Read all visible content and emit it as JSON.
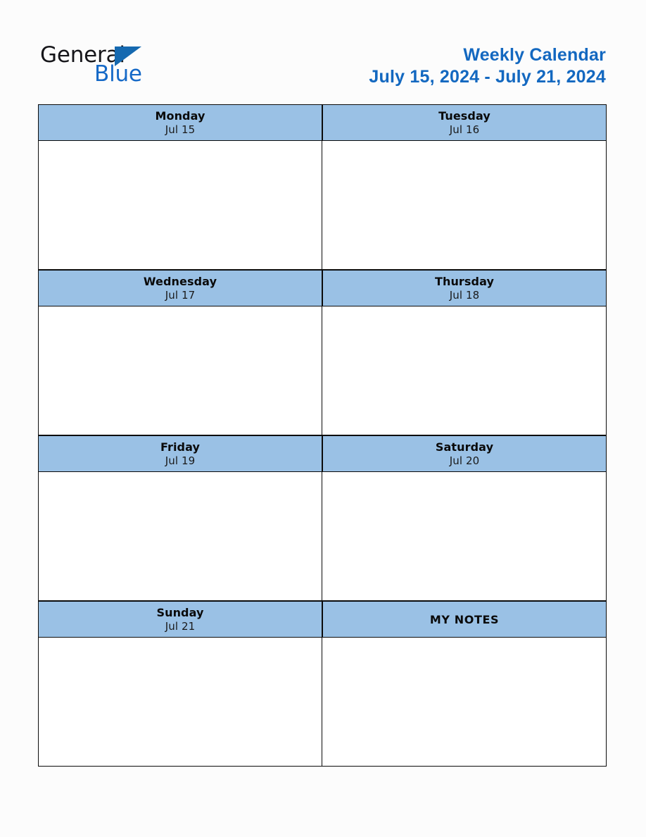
{
  "logo": {
    "word_primary": "General",
    "word_secondary": "Blue",
    "triangle_icon": "triangle-icon",
    "primary_color": "#16161a",
    "secondary_color": "#1569c7",
    "triangle_color": "#1569b0"
  },
  "header": {
    "title": "Weekly Calendar",
    "date_range": "July 15, 2024 - July 21, 2024",
    "title_color": "#1368c0"
  },
  "theme": {
    "header_cell_bg": "#9ac1e5",
    "border_color": "#0b0b0b",
    "page_bg": "#fcfcfc",
    "body_cell_bg": "#ffffff"
  },
  "calendar": {
    "rows": [
      {
        "cells": [
          {
            "name": "Monday",
            "date": "Jul 15",
            "type": "day"
          },
          {
            "name": "Tuesday",
            "date": "Jul 16",
            "type": "day"
          }
        ]
      },
      {
        "cells": [
          {
            "name": "Wednesday",
            "date": "Jul 17",
            "type": "day"
          },
          {
            "name": "Thursday",
            "date": "Jul 18",
            "type": "day"
          }
        ]
      },
      {
        "cells": [
          {
            "name": "Friday",
            "date": "Jul 19",
            "type": "day"
          },
          {
            "name": "Saturday",
            "date": "Jul 20",
            "type": "day"
          }
        ]
      },
      {
        "cells": [
          {
            "name": "Sunday",
            "date": "Jul 21",
            "type": "day"
          },
          {
            "name": "MY NOTES",
            "date": "",
            "type": "notes"
          }
        ]
      }
    ]
  }
}
